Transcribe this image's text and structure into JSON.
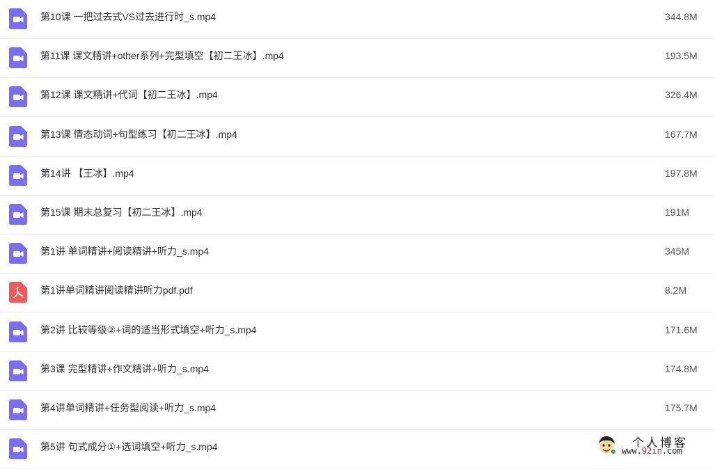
{
  "files": [
    {
      "name": "第10课 一把过去式VS过去进行时_s.mp4",
      "size": "344.8M",
      "type": "video"
    },
    {
      "name": "第11课 课文精讲+other系列+完型填空【初二王冰】.mp4",
      "size": "193.5M",
      "type": "video"
    },
    {
      "name": "第12课 课文精讲+代词【初二王冰】.mp4",
      "size": "326.4M",
      "type": "video"
    },
    {
      "name": "第13课 情态动词+句型练习【初二王冰】.mp4",
      "size": "167.7M",
      "type": "video"
    },
    {
      "name": "第14讲 【王冰】.mp4",
      "size": "197.8M",
      "type": "video"
    },
    {
      "name": "第15课 期末总复习【初二王冰】.mp4",
      "size": "191M",
      "type": "video"
    },
    {
      "name": "第1讲 单词精讲+阅读精讲+听力_s.mp4",
      "size": "345M",
      "type": "video"
    },
    {
      "name": "第1讲单词精讲阅读精讲听力pdf.pdf",
      "size": "8.2M",
      "type": "pdf"
    },
    {
      "name": "第2讲 比较等级②+词的适当形式填空+听力_s.mp4",
      "size": "171.6M",
      "type": "video"
    },
    {
      "name": "第3课 完型精讲+作文精讲+听力_s.mp4",
      "size": "174.8M",
      "type": "video"
    },
    {
      "name": "第4讲单词精讲+任务型阅读+听力_s.mp4",
      "size": "175.7M",
      "type": "video"
    },
    {
      "name": "第5讲 句式成分①+选词填空+听力_s.mp4",
      "size": "",
      "type": "video"
    }
  ],
  "icons": {
    "video": "video-file-icon",
    "pdf": "pdf-file-icon"
  },
  "colors": {
    "video_icon": "#7b6cf0",
    "pdf_icon": "#f15a5a",
    "divider": "#eeeeee"
  },
  "watermark": {
    "title": "个人博客",
    "url_prefix": "www.",
    "url_highlight": "92in",
    "url_suffix": ".com"
  }
}
